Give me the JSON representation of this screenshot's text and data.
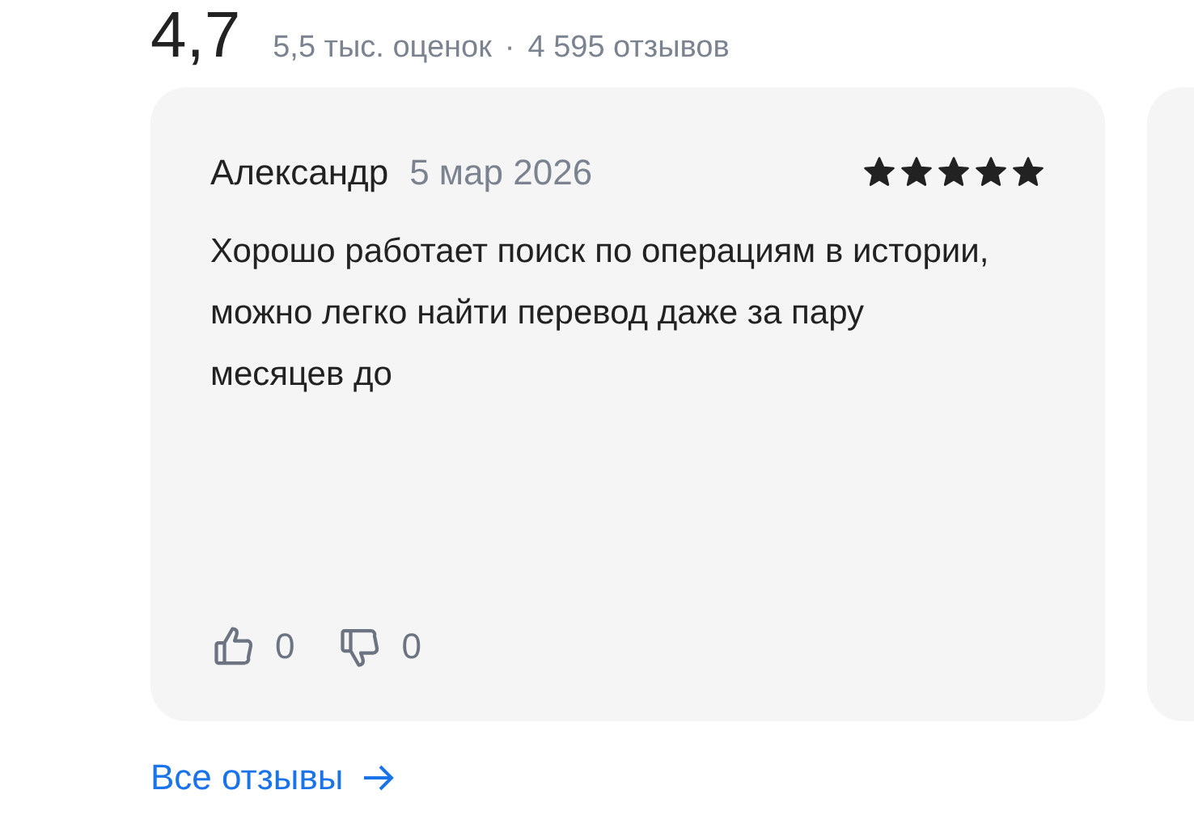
{
  "rating": {
    "value": "4,7",
    "ratings_count": "5,5 тыс. оценок",
    "separator": "·",
    "reviews_count": "4 595 отзывов"
  },
  "reviews": [
    {
      "author": "Александр",
      "date": "5 мар 2026",
      "stars": 5,
      "text": "Хорошо работает поиск по операциям в истории, можно легко найти перевод даже за пару месяцев до",
      "likes": "0",
      "dislikes": "0"
    }
  ],
  "all_reviews_link": "Все отзывы"
}
